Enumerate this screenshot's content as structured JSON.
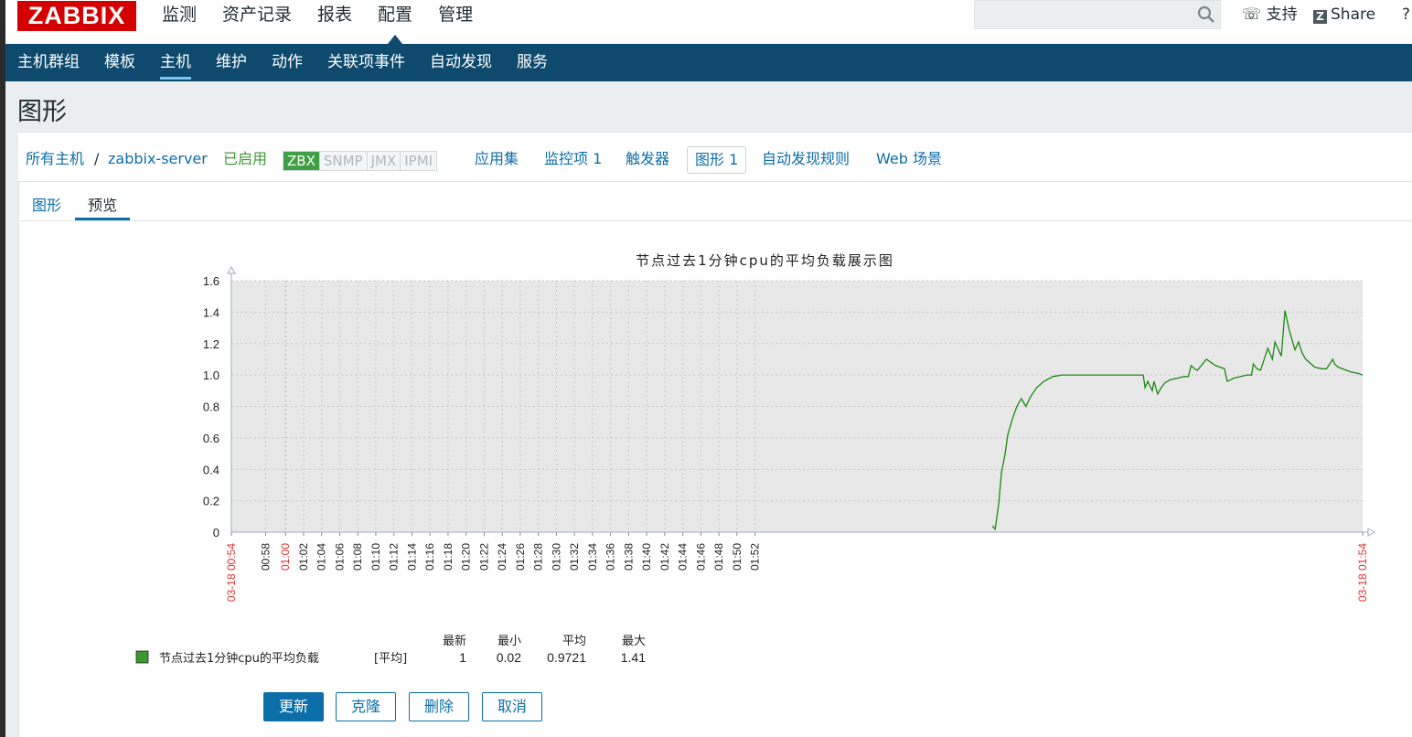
{
  "header": {
    "logo": "ZABBIX",
    "menu": [
      "监测",
      "资产记录",
      "报表",
      "配置",
      "管理"
    ],
    "active_menu": "配置",
    "support": "支持",
    "share": "Share",
    "help": "?"
  },
  "subnav": {
    "items": [
      "主机群组",
      "模板",
      "主机",
      "维护",
      "动作",
      "关联项事件",
      "自动发现",
      "服务"
    ],
    "active": "主机"
  },
  "page_title": "图形",
  "hostbar": {
    "all_hosts": "所有主机",
    "separator": "/",
    "host": "zabbix-server",
    "status": "已启用",
    "availability": [
      "ZBX",
      "SNMP",
      "JMX",
      "IPMI"
    ],
    "links": {
      "applications": "应用集",
      "items": "监控项 1",
      "triggers": "触发器",
      "graphs": "图形 1",
      "discovery": "自动发现规则",
      "web": "Web 场景"
    }
  },
  "tabs": [
    "图形",
    "预览"
  ],
  "active_tab": "预览",
  "chart_data": {
    "type": "line",
    "title": "节点过去1分钟cpu的平均负载展示图",
    "ylim": [
      0,
      1.6
    ],
    "y_ticks": [
      "0",
      "0.2",
      "0.4",
      "0.6",
      "0.8",
      "1.0",
      "1.2",
      "1.4",
      "1.6"
    ],
    "x_labels": [
      "03-18 00:54",
      "00:58",
      "01:00",
      "01:02",
      "01:04",
      "01:06",
      "01:08",
      "01:10",
      "01:12",
      "01:14",
      "01:16",
      "01:18",
      "01:20",
      "01:22",
      "01:24",
      "01:26",
      "01:28",
      "01:30",
      "01:32",
      "01:34",
      "01:36",
      "01:38",
      "01:40",
      "01:42",
      "01:44",
      "01:46",
      "01:48",
      "01:50",
      "01:52",
      "03-18 01:54"
    ],
    "grid": true,
    "series": [
      {
        "name": "节点过去1分钟cpu的平均负载",
        "color": "#1a8a10",
        "x": [
          84.3,
          84.6,
          85.0,
          85.3,
          85.7,
          86.0,
          86.5,
          87.0,
          87.5,
          88.0,
          88.5,
          89.2,
          90.0,
          91.0,
          92.0,
          93.0,
          94.0,
          95.0,
          96.0,
          98.0,
          100.0,
          101.0,
          101.2,
          101.5,
          102.0,
          102.2,
          102.6,
          103.0,
          103.4,
          104.0,
          104.8,
          105.5,
          106.0,
          106.3,
          106.7,
          107.0,
          108.0,
          109.0,
          110.0,
          110.3,
          110.7,
          111.0,
          111.8,
          112.5,
          113.0,
          113.2,
          113.6,
          114.0,
          114.8,
          115.3,
          115.6,
          116.3,
          116.7,
          117.2,
          117.8,
          118.2,
          118.6,
          119.0,
          120.0,
          120.8,
          121.3,
          122.0,
          122.2,
          122.6,
          123.5,
          124.0,
          124.8,
          125.3
        ],
        "values": [
          0.04,
          0.02,
          0.18,
          0.38,
          0.5,
          0.62,
          0.72,
          0.8,
          0.85,
          0.8,
          0.86,
          0.92,
          0.96,
          0.99,
          1.0,
          1.0,
          1.0,
          1.0,
          1.0,
          1.0,
          1.0,
          1.0,
          0.92,
          0.96,
          0.9,
          0.96,
          0.88,
          0.92,
          0.95,
          0.97,
          0.98,
          0.99,
          0.99,
          1.06,
          1.04,
          1.03,
          1.1,
          1.06,
          1.04,
          0.96,
          0.97,
          0.98,
          0.99,
          1.0,
          1.0,
          1.07,
          1.04,
          1.03,
          1.17,
          1.1,
          1.21,
          1.12,
          1.41,
          1.28,
          1.16,
          1.21,
          1.14,
          1.1,
          1.05,
          1.04,
          1.04,
          1.1,
          1.07,
          1.05,
          1.03,
          1.02,
          1.01,
          1.0
        ]
      }
    ],
    "legend": {
      "label": "节点过去1分钟cpu的平均负载",
      "func": "[平均]",
      "headers": [
        "最新",
        "最小",
        "平均",
        "最大"
      ],
      "values": [
        "1",
        "0.02",
        "0.9721",
        "1.41"
      ],
      "color": "#3a9a30"
    }
  },
  "buttons": {
    "update": "更新",
    "clone": "克隆",
    "delete": "删除",
    "cancel": "取消"
  }
}
